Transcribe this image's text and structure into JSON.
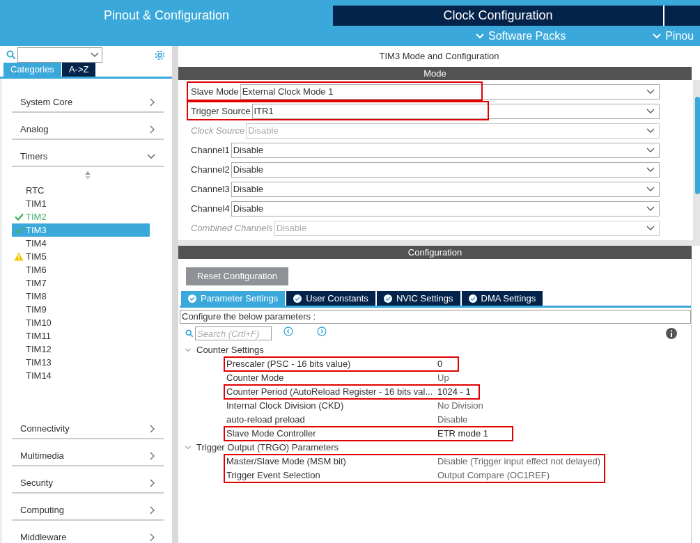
{
  "top_tabs": [
    {
      "label": "Pinout & Configuration",
      "selected": true
    },
    {
      "label": "Clock Configuration",
      "selected": false
    }
  ],
  "sub_menu": [
    "Software Packs",
    "Pinou"
  ],
  "sidebar": {
    "view_tabs": [
      {
        "label": "Categories",
        "selected": true
      },
      {
        "label": "A->Z",
        "selected": false
      }
    ],
    "categories_top": [
      {
        "label": "System Core",
        "expanded": false
      },
      {
        "label": "Analog",
        "expanded": false
      },
      {
        "label": "Timers",
        "expanded": true
      }
    ],
    "timers": [
      {
        "label": "RTC",
        "kind": "plain",
        "selected": false
      },
      {
        "label": "TIM1",
        "kind": "plain",
        "selected": false
      },
      {
        "label": "TIM2",
        "kind": "configured",
        "selected": false
      },
      {
        "label": "TIM3",
        "kind": "configured",
        "selected": true
      },
      {
        "label": "TIM4",
        "kind": "plain",
        "selected": false
      },
      {
        "label": "TIM5",
        "kind": "warning",
        "selected": false
      },
      {
        "label": "TIM6",
        "kind": "plain",
        "selected": false
      },
      {
        "label": "TIM7",
        "kind": "plain",
        "selected": false
      },
      {
        "label": "TIM8",
        "kind": "plain",
        "selected": false
      },
      {
        "label": "TIM9",
        "kind": "plain",
        "selected": false
      },
      {
        "label": "TIM10",
        "kind": "plain",
        "selected": false
      },
      {
        "label": "TIM11",
        "kind": "plain",
        "selected": false
      },
      {
        "label": "TIM12",
        "kind": "plain",
        "selected": false
      },
      {
        "label": "TIM13",
        "kind": "plain",
        "selected": false
      },
      {
        "label": "TIM14",
        "kind": "plain",
        "selected": false
      }
    ],
    "categories_bottom": [
      {
        "label": "Connectivity",
        "expanded": false
      },
      {
        "label": "Multimedia",
        "expanded": false
      },
      {
        "label": "Security",
        "expanded": false
      },
      {
        "label": "Computing",
        "expanded": false
      },
      {
        "label": "Middleware",
        "expanded": false
      }
    ]
  },
  "panel_title": "TIM3 Mode and Configuration",
  "mode": {
    "header": "Mode",
    "fields": [
      {
        "label": "Slave Mode",
        "value": "External Clock Mode 1",
        "disabled": false,
        "highlighted": true
      },
      {
        "label": "Trigger Source",
        "value": "ITR1",
        "disabled": false,
        "highlighted": true
      },
      {
        "label": "Clock Source",
        "value": "Disable",
        "disabled": true,
        "highlighted": false
      },
      {
        "label": "Channel1",
        "value": "Disable",
        "disabled": false,
        "highlighted": false
      },
      {
        "label": "Channel2",
        "value": "Disable",
        "disabled": false,
        "highlighted": false
      },
      {
        "label": "Channel3",
        "value": "Disable",
        "disabled": false,
        "highlighted": false
      },
      {
        "label": "Channel4",
        "value": "Disable",
        "disabled": false,
        "highlighted": false
      },
      {
        "label": "Combined Channels",
        "value": "Disable",
        "disabled": true,
        "highlighted": false
      }
    ]
  },
  "configuration": {
    "header": "Configuration",
    "reset_button": "Reset Configuration",
    "tabs": [
      {
        "label": "Parameter Settings",
        "selected": true
      },
      {
        "label": "User Constants",
        "selected": false
      },
      {
        "label": "NVIC Settings",
        "selected": false
      },
      {
        "label": "DMA Settings",
        "selected": false
      }
    ],
    "hint": "Configure the below parameters :",
    "search": {
      "placeholder": "Search (Crtl+F)"
    },
    "groups": [
      {
        "label": "Counter Settings",
        "expanded": true,
        "rows": [
          {
            "name": "Prescaler (PSC - 16 bits value)",
            "value": "0",
            "modified": true,
            "highlighted": true
          },
          {
            "name": "Counter Mode",
            "value": "Up",
            "modified": false,
            "highlighted": false
          },
          {
            "name": "Counter Period (AutoReload Register - 16 bits val...",
            "value": "1024 - 1",
            "modified": true,
            "highlighted": true
          },
          {
            "name": "Internal Clock Division (CKD)",
            "value": "No Division",
            "modified": false,
            "highlighted": false
          },
          {
            "name": "auto-reload preload",
            "value": "Disable",
            "modified": false,
            "highlighted": false
          },
          {
            "name": "Slave Mode Controller",
            "value": "ETR mode 1",
            "modified": true,
            "highlighted": true
          }
        ]
      },
      {
        "label": "Trigger Output (TRGO) Parameters",
        "expanded": true,
        "rows": [
          {
            "name": "Master/Slave Mode (MSM bit)",
            "value": "Disable (Trigger input effect not delayed)",
            "modified": false,
            "highlighted": true
          },
          {
            "name": "Trigger Event Selection",
            "value": "Output Compare (OC1REF)",
            "modified": false,
            "highlighted": true
          }
        ]
      }
    ]
  }
}
